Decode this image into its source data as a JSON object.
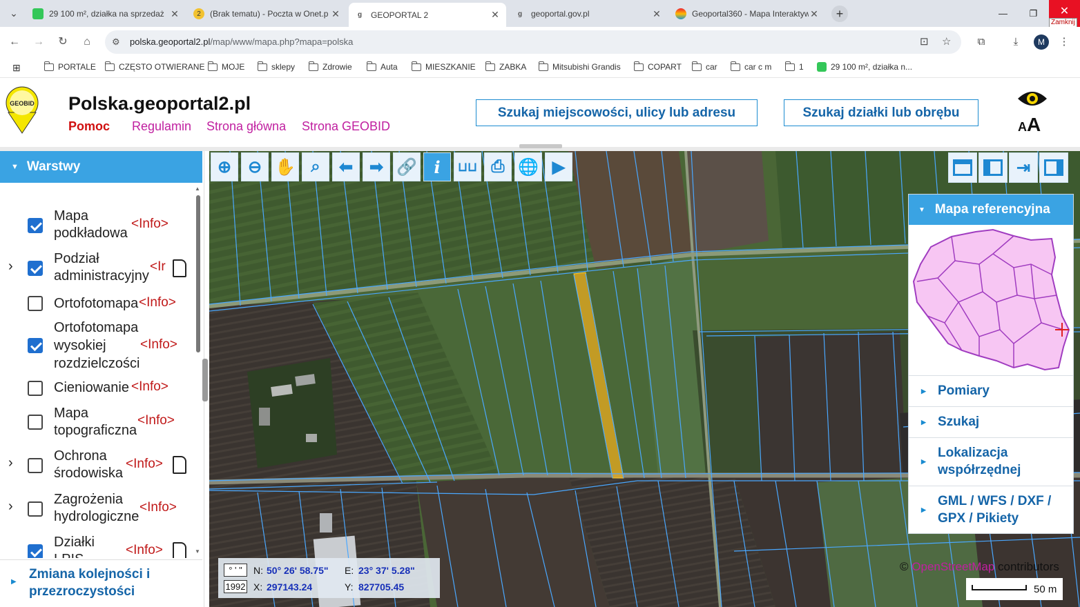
{
  "browser": {
    "tabs": [
      {
        "title": "29 100 m², działka na sprzedaż",
        "favicon": "green-square-icon",
        "active": false
      },
      {
        "title": "(Brak tematu) - Poczta w Onet.p",
        "favicon": "onet-badge-icon",
        "badge": "2",
        "active": false
      },
      {
        "title": "GEOPORTAL 2",
        "favicon": "geoportal-icon",
        "active": true
      },
      {
        "title": "geoportal.gov.pl",
        "favicon": "geoportal-icon",
        "active": false
      },
      {
        "title": "Geoportal360 - Mapa Interaktyw",
        "favicon": "geoportal360-icon",
        "active": false
      }
    ],
    "close_tooltip": "Zamknij",
    "address": {
      "domain": "polska.geoportal2.pl",
      "path": "/map/www/mapa.php?mapa=polska"
    },
    "avatar_letter": "M",
    "bookmarks": [
      "PORTALE",
      "CZĘSTO OTWIERANE",
      "MOJE",
      "sklepy",
      "Zdrowie",
      "Auta",
      "MIESZKANIE",
      "ZABKA",
      "Mitsubishi Grandis",
      "COPART",
      "car",
      "car c m",
      "1",
      "29 100 m², działka n..."
    ]
  },
  "site": {
    "logo_text": "GEOBID",
    "title": "Polska.geoportal2.pl",
    "nav": [
      "Pomoc",
      "Regulamin",
      "Strona główna",
      "Strona GEOBID"
    ],
    "search_place": "Szukaj miejscowości, ulicy lub adresu",
    "search_parcel": "Szukaj działki lub obrębu",
    "font_small": "A",
    "font_large": "A"
  },
  "layers_panel": {
    "title": "Warstwy",
    "info": "<Info>",
    "info_cut": "<Ir",
    "layers": [
      {
        "line1": "Mapa",
        "line2": "podkładowa",
        "checked": true,
        "expandable": false
      },
      {
        "line1": "Podział",
        "line2": "administracyjny",
        "checked": true,
        "expandable": true
      },
      {
        "line1": "Ortofotomapa",
        "checked": false,
        "expandable": false
      },
      {
        "line1": "Ortofotomapa",
        "line2": "wysokiej",
        "line3": "rozdzielczości",
        "checked": true,
        "expandable": false
      },
      {
        "line1": "Cieniowanie",
        "checked": false,
        "expandable": false
      },
      {
        "line1": "Mapa",
        "line2": "topograficzna",
        "checked": false,
        "expandable": false
      },
      {
        "line1": "Ochrona",
        "line2": "środowiska",
        "checked": false,
        "expandable": true
      },
      {
        "line1": "Zagrożenia",
        "line2": "hydrologiczne",
        "checked": false,
        "expandable": true
      },
      {
        "line1": "Działki",
        "line2": "LPIS",
        "checked": true,
        "expandable": false
      }
    ],
    "footer": {
      "line1": "Zmiana kolejności i",
      "line2": "przezroczystości"
    }
  },
  "map_tools": [
    "zoom-in-icon",
    "zoom-out-icon",
    "pan-hand-icon",
    "zoom-extent-icon",
    "back-arrow-icon",
    "forward-arrow-icon",
    "link-icon",
    "info-icon",
    "measure-ruler-icon",
    "print-icon",
    "globe-icon",
    "video-icon"
  ],
  "view_tools": [
    "full-window-icon",
    "left-panel-icon",
    "export-arrow-icon",
    "right-panel-icon"
  ],
  "right_panel": {
    "title": "Mapa referencyjna",
    "items": [
      {
        "line1": "Pomiary"
      },
      {
        "line1": "Szukaj"
      },
      {
        "line1": "Lokalizacja",
        "line2": "współrzędnej"
      },
      {
        "line1": "GML / WFS / DXF /",
        "line2": "GPX / Pikiety"
      }
    ]
  },
  "coordinates": {
    "format_dms": "° ' \"",
    "format_system": "1992",
    "n_label": "N:",
    "n_value": "50° 26' 58.75\"",
    "e_label": "E:",
    "e_value": "23° 37' 5.28\"",
    "x_label": "X:",
    "x_value": "297143.24",
    "y_label": "Y:",
    "y_value": "827705.45"
  },
  "attribution": {
    "prefix": "©",
    "link": "OpenStreetMap",
    "suffix": "contributors"
  },
  "scale": "50 m",
  "colors": {
    "accent": "#3aa3e3",
    "link_blue": "#1565a8",
    "nav_magenta": "#c020a0",
    "help_red": "#d01010",
    "parcel_line": "#4aa8ff",
    "selected_parcel": "#e8b020"
  }
}
